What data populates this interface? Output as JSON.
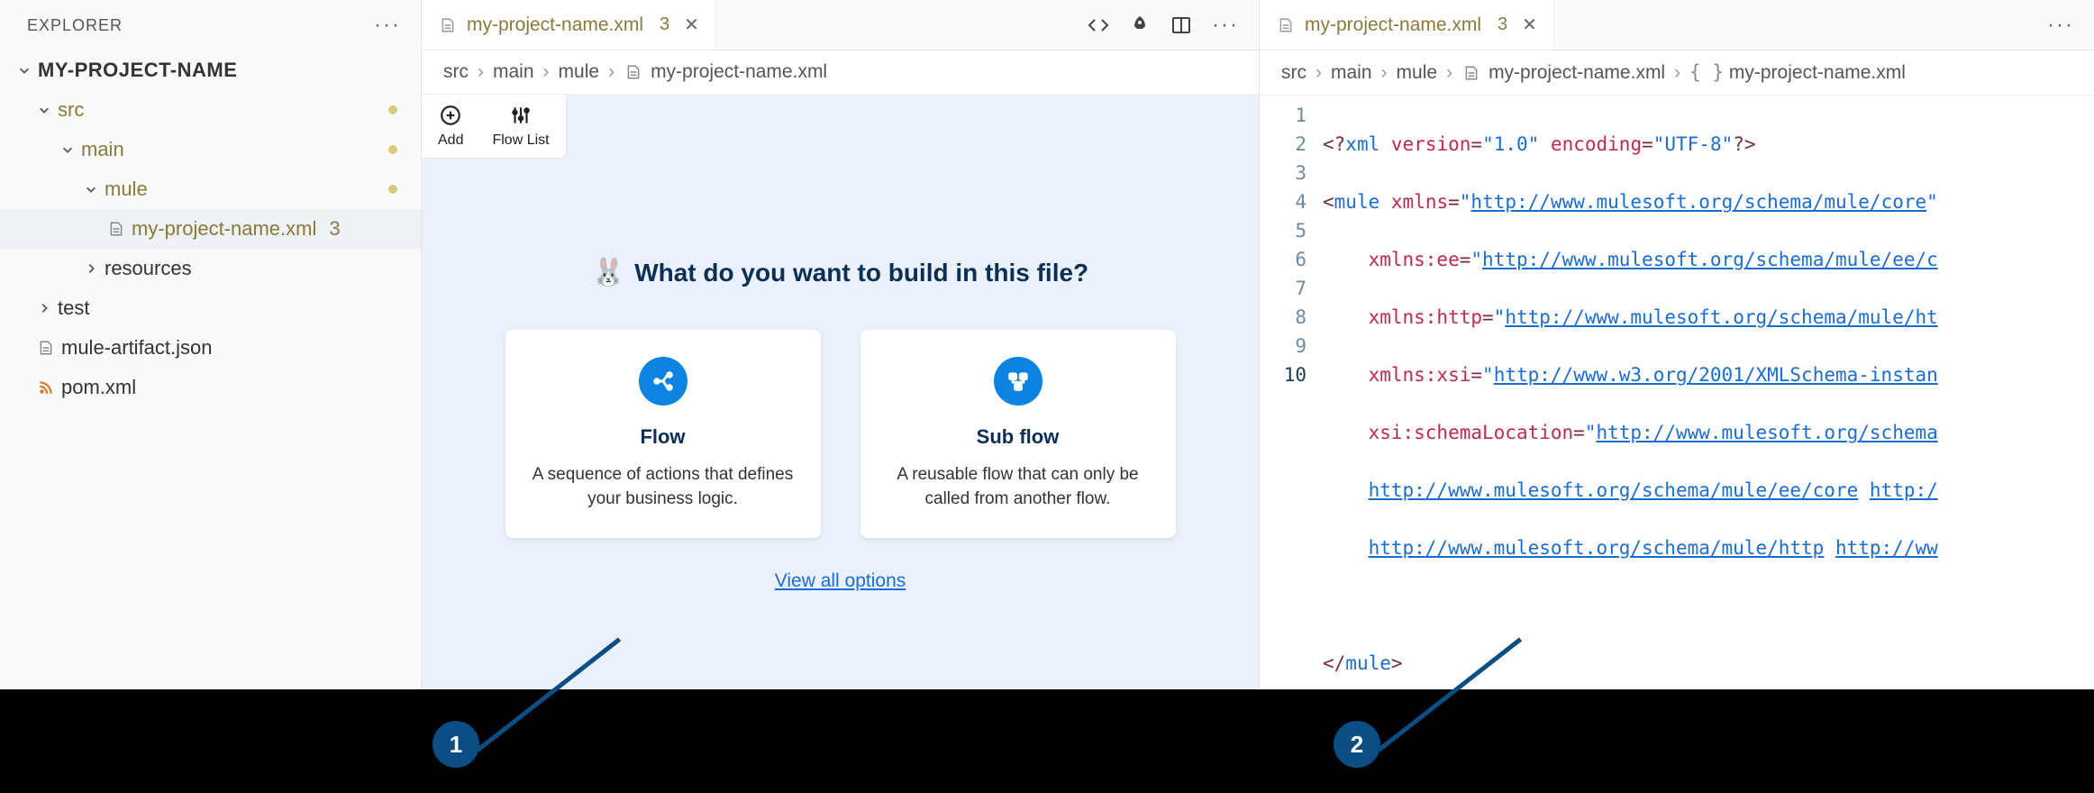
{
  "explorer": {
    "title": "EXPLORER",
    "project": "MY-PROJECT-NAME",
    "tree": {
      "src": "src",
      "main": "main",
      "mule": "mule",
      "file": "my-project-name.xml",
      "file_badge": "3",
      "resources": "resources",
      "test": "test",
      "artifact": "mule-artifact.json",
      "pom": "pom.xml"
    }
  },
  "designer": {
    "tab_label": "my-project-name.xml",
    "tab_badge": "3",
    "breadcrumbs": {
      "src": "src",
      "main": "main",
      "mule": "mule",
      "file": "my-project-name.xml"
    },
    "tools": {
      "add": "Add",
      "flowlist": "Flow List"
    },
    "hero_title": "What do you want to build in this file?",
    "cards": {
      "flow": {
        "title": "Flow",
        "desc": "A sequence of actions that defines your business logic."
      },
      "subflow": {
        "title": "Sub flow",
        "desc": "A reusable flow that can only be called from another flow."
      }
    },
    "view_all": "View all options"
  },
  "coder": {
    "tab_label": "my-project-name.xml",
    "tab_badge": "3",
    "breadcrumbs": {
      "src": "src",
      "main": "main",
      "mule": "mule",
      "file": "my-project-name.xml",
      "sym": "my-project-name.xml"
    },
    "lines": {
      "l1_pi": "<?xml version=\"1.0\" encoding=\"UTF-8\"?>",
      "l2_a": "<mule ",
      "l2_attr": "xmlns",
      "l2_eq": "=",
      "l2_url": "http://www.mulesoft.org/schema/mule/core",
      "l3_attr": "xmlns:ee",
      "l3_url": "http://www.mulesoft.org/schema/mule/ee/c",
      "l4_attr": "xmlns:http",
      "l4_url": "http://www.mulesoft.org/schema/mule/ht",
      "l5_attr": "xmlns:xsi",
      "l5_url": "http://www.w3.org/2001/XMLSchema-instan",
      "l6_attr": "xsi:schemaLocation",
      "l6_url": "http://www.mulesoft.org/schema",
      "l7_url1": "http://www.mulesoft.org/schema/mule/ee/core",
      "l7_url2": "http:/",
      "l8_url1": "http://www.mulesoft.org/schema/mule/http",
      "l8_url2": "http://ww",
      "l10": "</mule>"
    }
  },
  "callouts": {
    "one": "1",
    "two": "2"
  }
}
